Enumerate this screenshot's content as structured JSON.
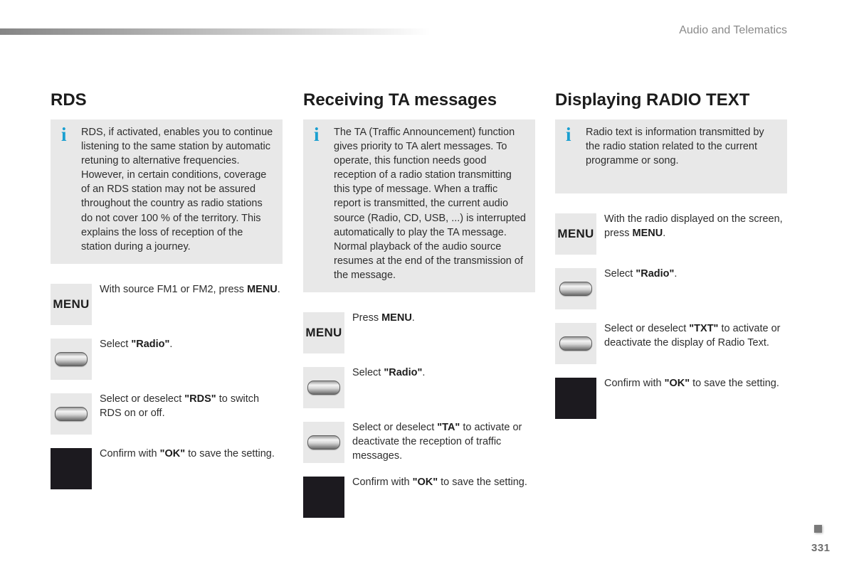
{
  "header": {
    "chapter_title": "Audio and Telematics"
  },
  "sections": [
    {
      "title": "RDS",
      "info": "RDS, if activated, enables you to continue listening to the same station by automatic retuning to alternative frequencies. However, in certain conditions, coverage of an RDS station may not be assured throughout the country as radio stations do not cover 100 % of the territory. This explains the loss of reception of the station during a journey.",
      "steps": [
        {
          "icon": "menu-button-icon",
          "icon_label": "MENU",
          "pre": "With source FM1 or FM2, press ",
          "bold": "MENU",
          "post": "."
        },
        {
          "icon": "select-button-icon",
          "pre": "Select ",
          "bold": "\"Radio\"",
          "post": "."
        },
        {
          "icon": "select-button-icon",
          "pre": "Select or deselect ",
          "bold": "\"RDS\"",
          "post": " to switch RDS on or off."
        },
        {
          "icon": "ok-button-icon",
          "pre": "Confirm with ",
          "bold": "\"OK\"",
          "post": " to save the setting."
        }
      ]
    },
    {
      "title": "Receiving TA messages",
      "info": "The TA (Traffic Announcement) function gives priority to TA alert messages. To operate, this function needs good reception of a radio station transmitting this type of message. When a traffic report is transmitted, the current audio source (Radio, CD, USB, ...) is interrupted automatically to play the TA message. Normal playback of the audio source resumes at the end of the transmission of the message.",
      "steps": [
        {
          "icon": "menu-button-icon",
          "icon_label": "MENU",
          "pre": "Press ",
          "bold": "MENU",
          "post": "."
        },
        {
          "icon": "select-button-icon",
          "pre": "Select ",
          "bold": "\"Radio\"",
          "post": "."
        },
        {
          "icon": "select-button-icon",
          "pre": "Select or deselect ",
          "bold": "\"TA\"",
          "post": " to activate or deactivate the reception of traffic messages."
        },
        {
          "icon": "ok-button-icon",
          "pre": "Confirm with ",
          "bold": "\"OK\"",
          "post": " to save the setting."
        }
      ]
    },
    {
      "title": "Displaying RADIO TEXT",
      "info": "Radio text is information transmitted by the radio station related to the current programme or song.",
      "steps": [
        {
          "icon": "menu-button-icon",
          "icon_label": "MENU",
          "pre": "With the radio displayed on the screen, press ",
          "bold": "MENU",
          "post": "."
        },
        {
          "icon": "select-button-icon",
          "pre": "Select ",
          "bold": "\"Radio\"",
          "post": "."
        },
        {
          "icon": "select-button-icon",
          "pre": "Select or deselect ",
          "bold": "\"TXT\"",
          "post": " to activate or deactivate the display of Radio Text."
        },
        {
          "icon": "ok-button-icon",
          "pre": "Confirm with ",
          "bold": "\"OK\"",
          "post": " to save the setting."
        }
      ]
    }
  ],
  "footer": {
    "page_number": "331"
  },
  "colors": {
    "info_icon": "#1a9fd0",
    "info_box_bg": "#e8e8e8",
    "ok_button": "#1c1a1f"
  }
}
